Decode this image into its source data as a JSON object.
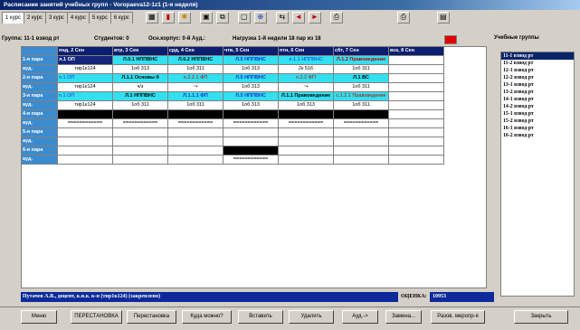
{
  "window": {
    "title": "Расписание занятий учебных групп - Voropaeva12-1z1     (1-я неделя)"
  },
  "tabs": [
    "1 курс",
    "2 курс",
    "3 курс",
    "4 курс",
    "5 курс",
    "6 курс"
  ],
  "toolbar_icons": [
    "grid-icon",
    "book-icon",
    "run-icon",
    "save-icon",
    "copy-icon",
    "square-icon",
    "add-circle-icon",
    "step-icon",
    "arrow-left-icon",
    "arrow-right-icon",
    "print-icon",
    "print-icon",
    "doc-icon"
  ],
  "info": {
    "group": "Группа: 11-1 взвод рт",
    "students": "Студентов: 0",
    "building": "Осн.корпус: 0-й Ауд.:",
    "load": "Нагрузка 1-й недели 18 пар из 18"
  },
  "sidebar": {
    "label": "Учебные группы",
    "items": [
      "11-1 взвод рт",
      "11-2 взвод рт",
      "12-1 взвод рт",
      "12-2 взвод рт",
      "13-1 взвод рт",
      "13-2 взвод рт",
      "14-1 взвод рт",
      "14-2 взвод рт",
      "15-1 взвод рт",
      "15-2 взвод рт",
      "16-1 взвод рт",
      "16-2 взвод рт"
    ],
    "selected": 0
  },
  "schedule": {
    "days": [
      "пнд, 2 Сен",
      "втр, 3 Сен",
      "срд, 4 Сен",
      "чтв, 5 Сен",
      "птн, 6 Сен",
      "сбт, 7 Сен",
      "вск, 8 Сен"
    ],
    "rows": [
      {
        "label": "1-я пара",
        "cells": [
          "л.1 ОП",
          "Л.0.1 НППВНС",
          "Л.0.2 НППВНС",
          "Л.5 НППВНС",
          "л.1.1 НППВНС",
          "Л.1.2 Правоведение",
          ""
        ]
      },
      {
        "label": "ауд.",
        "cells": [
          "тир1к124",
          "1об 313",
          "1об 311",
          "1об 313",
          "2к 516",
          "1об 311",
          ""
        ]
      },
      {
        "label": "2-я пара",
        "cells": [
          "п.1 ОП",
          "Л.1.1 Основы б",
          "п.2.2.1 ФП",
          "Л.5 НППВНС",
          "п.2.2 ФП",
          "Л.1 ВС",
          ""
        ]
      },
      {
        "label": "ауд.",
        "cells": [
          "тир1к124",
          "ч/з",
          "~•",
          "1об 313",
          "~•",
          "1об 311",
          ""
        ]
      },
      {
        "label": "3-я пара",
        "cells": [
          "п.1 ОП",
          "Л.1 НППВНС",
          "Л.1.1.1 ФП",
          "Л.5 НППВНС",
          "Л.1.1 Правоведение",
          "с.1.2.1 Правоведение",
          ""
        ]
      },
      {
        "label": "ауд.",
        "cells": [
          "тир1к124",
          "1об 311",
          "1об 311",
          "1об 313",
          "1об 313",
          "1об 311",
          ""
        ]
      },
      {
        "label": "4-я пара",
        "cells": [
          "",
          "",
          "",
          "",
          "",
          "",
          ""
        ]
      },
      {
        "label": "ауд.",
        "cells": [
          "============",
          "============",
          "============",
          "============",
          "============",
          "============",
          ""
        ]
      },
      {
        "label": "5-я пара",
        "cells": [
          "",
          "",
          "",
          "",
          "",
          "",
          ""
        ]
      },
      {
        "label": "ауд.",
        "cells": [
          "",
          "",
          "",
          "",
          "",
          "",
          ""
        ]
      },
      {
        "label": "6-я пара",
        "cells": [
          "",
          "",
          "",
          "",
          "",
          "",
          ""
        ]
      },
      {
        "label": "ауд.",
        "cells": [
          "",
          "",
          "",
          "============",
          "",
          "",
          ""
        ]
      }
    ],
    "colors": {
      "navy": "#15257a",
      "cyan": "#33e0f0",
      "header": "#0c1e6e",
      "rowhead": "#3b8bd0"
    }
  },
  "footer": {
    "teacher": "Путачев А.В., доцент, к.н.к. к-н (тир1к124) (закреплено)",
    "score_label": "ОЦЕНКА:",
    "score_value": "10953"
  },
  "buttons": [
    "Меню",
    "ПЕРЕСТАНОВКА",
    "Перестановка",
    "Куда можно?",
    "Вставить",
    "Удалить",
    "Ауд.->",
    "Замена...",
    "Разов. меропр-я",
    "Закрыть"
  ]
}
